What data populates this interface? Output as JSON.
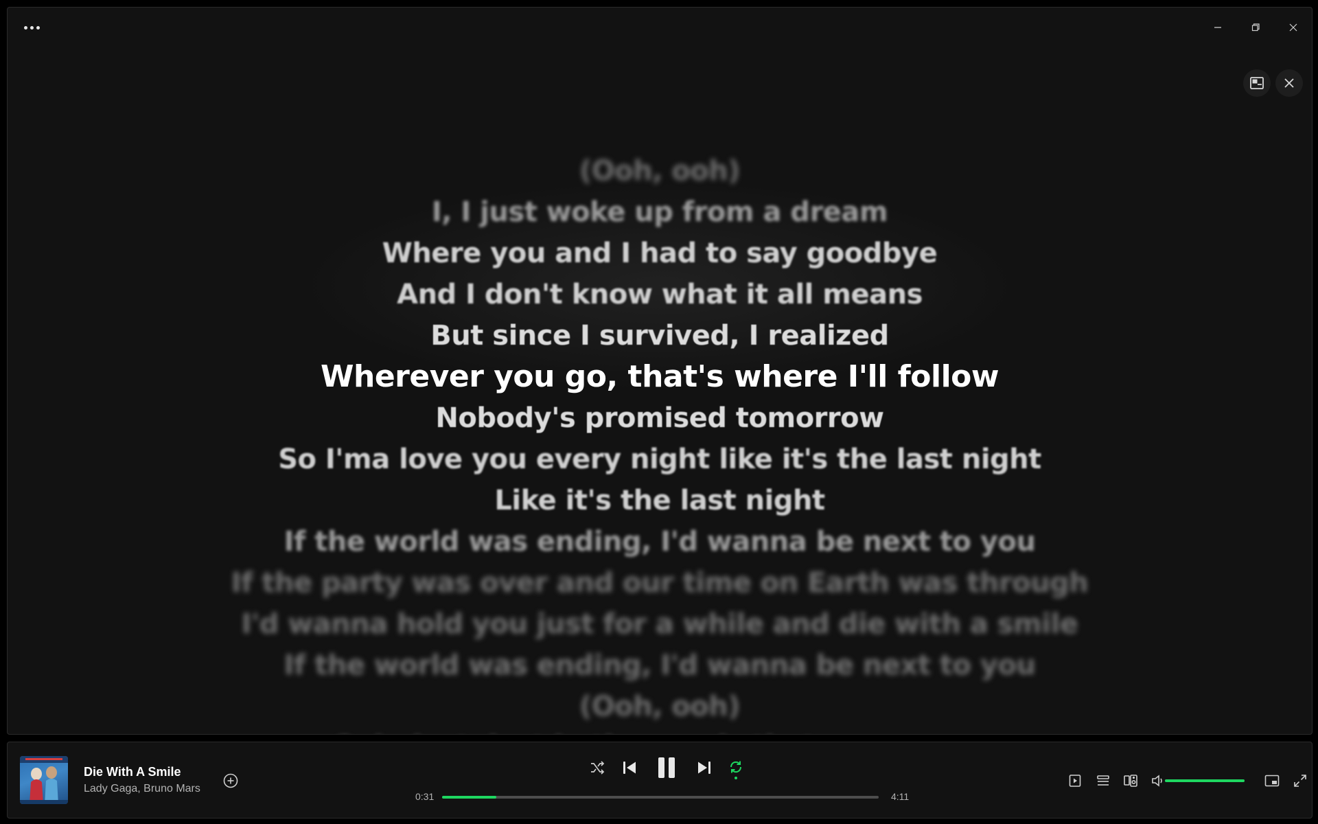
{
  "colors": {
    "accent": "#1ed760",
    "background": "#121212",
    "text_active": "#ffffff",
    "text_muted": "#b3b3b3"
  },
  "titlebar": {
    "more_icon": "more-horizontal-icon",
    "minimize_icon": "minimize-icon",
    "restore_icon": "restore-icon",
    "close_icon": "close-icon"
  },
  "lyrics_panel": {
    "miniplayer_icon": "miniplayer-icon",
    "close_icon": "close-icon",
    "lines": [
      {
        "text": "(Ooh, ooh)",
        "state": "far"
      },
      {
        "text": "I, I just woke up from a dream",
        "state": "near2"
      },
      {
        "text": "Where you and I had to say goodbye",
        "state": "near1"
      },
      {
        "text": "And I don't know what it all means",
        "state": "near1"
      },
      {
        "text": "But since I survived, I realized",
        "state": "near0"
      },
      {
        "text": "Wherever you go, that's where I'll follow",
        "state": "active"
      },
      {
        "text": "Nobody's promised tomorrow",
        "state": "near0"
      },
      {
        "text": "So I'ma love you every night like it's the last night",
        "state": "near1"
      },
      {
        "text": "Like it's the last night",
        "state": "near1"
      },
      {
        "text": "If the world was ending, I'd wanna be next to you",
        "state": "near2"
      },
      {
        "text": "If the party was over and our time on Earth was through",
        "state": "far"
      },
      {
        "text": "I'd wanna hold you just for a while and die with a smile",
        "state": "far"
      },
      {
        "text": "If the world was ending, I'd wanna be next to you",
        "state": "far"
      },
      {
        "text": "(Ooh, ooh)",
        "state": "far"
      },
      {
        "text": "Ooh, lost, lost in the words that we scream",
        "state": "far"
      }
    ]
  },
  "now_playing": {
    "title": "Die With A Smile",
    "artist": "Lady Gaga, Bruno Mars",
    "add_icon": "plus-circle-icon"
  },
  "playback": {
    "shuffle_icon": "shuffle-icon",
    "previous_icon": "skip-back-icon",
    "pause_icon": "pause-icon",
    "next_icon": "skip-forward-icon",
    "repeat_icon": "repeat-icon",
    "repeat_active": true,
    "elapsed": "0:31",
    "duration": "4:11",
    "progress_fraction": 0.124
  },
  "extra_controls": {
    "now_playing_view_icon": "now-playing-view-icon",
    "queue_icon": "queue-icon",
    "connect_device_icon": "connect-device-icon",
    "volume_icon": "volume-icon",
    "volume_fraction": 1.0,
    "miniplayer_icon": "miniplayer-icon",
    "fullscreen_icon": "fullscreen-icon"
  }
}
